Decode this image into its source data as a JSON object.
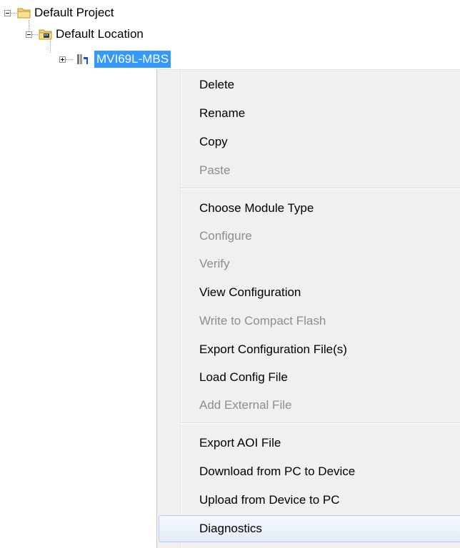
{
  "tree": {
    "root": {
      "label": "Default Project",
      "expanded": true,
      "icon": "folder-icon"
    },
    "location": {
      "label": "Default Location",
      "expanded": true,
      "icon": "location-folder-icon"
    },
    "module": {
      "label": "MVI69L-MBS",
      "expanded": false,
      "selected": true,
      "icon": "module-device-icon"
    }
  },
  "menu": {
    "items": [
      {
        "label": "Delete",
        "enabled": true
      },
      {
        "label": "Rename",
        "enabled": true
      },
      {
        "label": "Copy",
        "enabled": true
      },
      {
        "label": "Paste",
        "enabled": false
      },
      {
        "label": "Choose Module Type",
        "enabled": true
      },
      {
        "label": "Configure",
        "enabled": false
      },
      {
        "label": "Verify",
        "enabled": false
      },
      {
        "label": "View Configuration",
        "enabled": true
      },
      {
        "label": "Write to Compact Flash",
        "enabled": false
      },
      {
        "label": "Export Configuration File(s)",
        "enabled": true
      },
      {
        "label": "Load Config File",
        "enabled": true
      },
      {
        "label": "Add External File",
        "enabled": false
      },
      {
        "label": "Export AOI File",
        "enabled": true
      },
      {
        "label": "Download from PC to Device",
        "enabled": true
      },
      {
        "label": "Upload from Device to PC",
        "enabled": true
      },
      {
        "label": "Diagnostics",
        "enabled": true,
        "highlighted": true
      }
    ]
  },
  "colors": {
    "selection": "#3399ff",
    "menu_background": "#f0f0f0",
    "disabled_text": "#8d8d8d",
    "hover_border": "#aecff7"
  }
}
